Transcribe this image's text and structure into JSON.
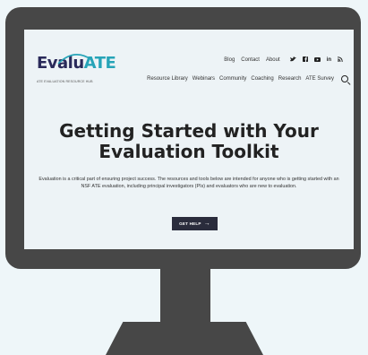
{
  "header": {
    "logo_text_main": "Evalu",
    "logo_text_accent": "ATE",
    "logo_subtitle": "ATE EVALUATION RESOURCE HUB",
    "top_nav": [
      "Blog",
      "Contact",
      "About"
    ],
    "social_icons": {
      "twitter": "🐦",
      "facebook": "f",
      "youtube": "▶",
      "linkedin": "in",
      "rss": "⟩"
    },
    "main_nav": [
      "Resource Library",
      "Webinars",
      "Community",
      "Coaching",
      "Research",
      "ATE Survey"
    ]
  },
  "hero": {
    "title_line1": "Getting Started with Your",
    "title_line2": "Evaluation Toolkit",
    "description": "Evaluation is a critical part of ensuring project success. The resources and tools below are intended for anyone who is getting started with an NSF ATE evaluation, including principal investigators (PIs) and evaluators who are new to evaluation.",
    "cta_label": "GET HELP",
    "cta_arrow": "→"
  },
  "colors": {
    "frame": "#474747",
    "screen_bg": "#edf3f6",
    "page_bg": "#eef6f9",
    "accent": "#27a4b8",
    "button": "#2a2c3c"
  }
}
